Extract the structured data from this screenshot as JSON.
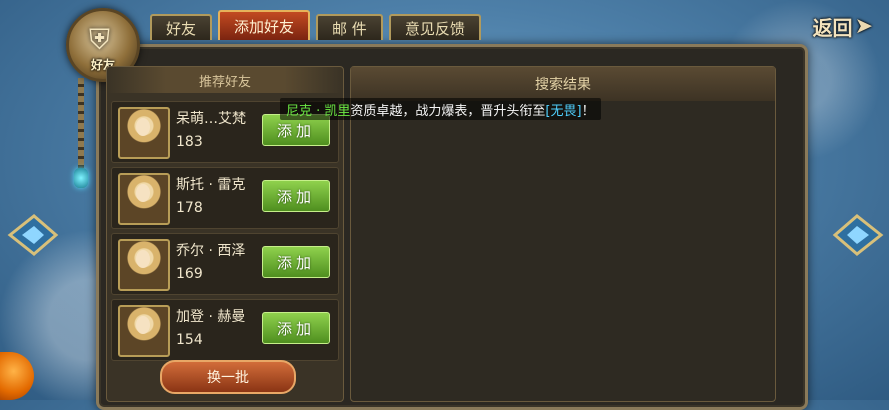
{
  "tabs": [
    {
      "label": "好友",
      "active": false
    },
    {
      "label": "添加好友",
      "active": true
    },
    {
      "label": "邮 件",
      "active": false
    },
    {
      "label": "意见反馈",
      "active": false
    }
  ],
  "emblem_label": "好友",
  "back_label": "返回",
  "recommend": {
    "title": "推荐好友",
    "friends": [
      {
        "name": "呆萌…艾梵",
        "level": "183",
        "add_label": "添加"
      },
      {
        "name": "斯托 · 雷克",
        "level": "178",
        "add_label": "添加"
      },
      {
        "name": "乔尔 · 西泽",
        "level": "169",
        "add_label": "添加"
      },
      {
        "name": "加登 · 赫曼",
        "level": "154",
        "add_label": "添加"
      }
    ],
    "refresh_label": "换一批"
  },
  "search": {
    "title": "搜索结果"
  },
  "announcement": {
    "player": "尼克 · 凯里",
    "text_middle": "资质卓越，战力爆表，晋升头衔至",
    "title": "[无畏]",
    "text_end": "！"
  },
  "colors": {
    "accent_green": "#6bea43",
    "accent_blue": "#4fd0ff",
    "active_tab": "#c24a21",
    "add_button": "#6fb534"
  },
  "icons": [
    "shield-icon",
    "back-arrow-icon",
    "nav-left-arrow-icon",
    "nav-right-arrow-icon",
    "portrait-icon"
  ]
}
